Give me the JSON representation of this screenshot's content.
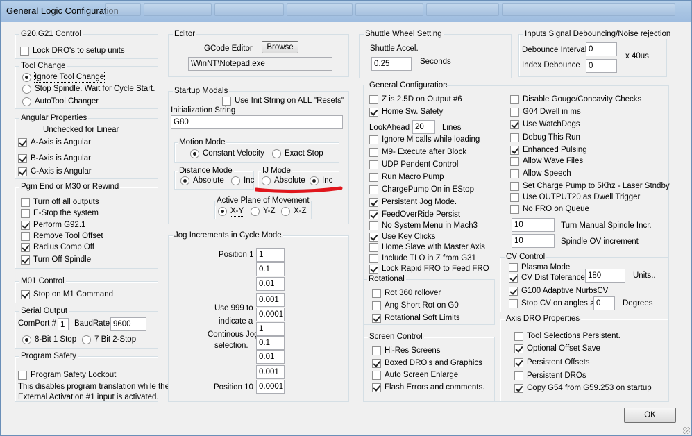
{
  "window": {
    "title": "General Logic Configuration"
  },
  "g2021": {
    "label": "G20,G21 Control",
    "lock_dros": {
      "label": "Lock DRO's to setup units",
      "checked": false
    }
  },
  "tool_change": {
    "label": "Tool Change",
    "options": [
      {
        "label": "Ignore Tool Change",
        "selected": true
      },
      {
        "label": "Stop Spindle. Wait for Cycle Start.",
        "selected": false
      },
      {
        "label": "AutoTool Changer",
        "selected": false
      }
    ]
  },
  "angular": {
    "label": "Angular Properties",
    "note": "Unchecked for Linear",
    "items": [
      {
        "label": "A-Axis is Angular",
        "checked": true
      },
      {
        "label": "B-Axis is Angular",
        "checked": true
      },
      {
        "label": "C-Axis is Angular",
        "checked": true
      }
    ]
  },
  "pgm_end": {
    "label": "Pgm End or M30 or Rewind",
    "items": [
      {
        "label": "Turn off all outputs",
        "checked": false
      },
      {
        "label": "E-Stop the system",
        "checked": false
      },
      {
        "label": "Perform G92.1",
        "checked": true
      },
      {
        "label": "Remove Tool Offset",
        "checked": false
      },
      {
        "label": "Radius Comp Off",
        "checked": true
      },
      {
        "label": "Turn Off Spindle",
        "checked": true
      }
    ]
  },
  "m01": {
    "label": "M01 Control",
    "stop_m1": {
      "label": "Stop on M1 Command",
      "checked": true
    }
  },
  "serial": {
    "label": "Serial Output",
    "comport_label": "ComPort #",
    "comport_value": "1",
    "baud_label": "BaudRate",
    "baud_value": "9600",
    "bit8": {
      "label": "8-Bit 1 Stop",
      "selected": true
    },
    "bit7": {
      "label": "7 Bit 2-Stop",
      "selected": false
    }
  },
  "program_safety": {
    "label": "Program Safety",
    "lockout": {
      "label": "Program Safety Lockout",
      "checked": false
    },
    "desc1": "This disables program translation while the",
    "desc2": "External Activation #1 input is activated."
  },
  "editor": {
    "label": "Editor",
    "gcode_label": "GCode Editor",
    "browse": "Browse",
    "path": "\\WinNT\\Notepad.exe"
  },
  "startup": {
    "label": "Startup Modals",
    "use_init": {
      "label": "Use Init String on ALL  \"Resets\"",
      "checked": false
    },
    "init_label": "Initialization String",
    "init_value": "G80",
    "motion": {
      "label": "Motion Mode",
      "constant": {
        "label": "Constant Velocity",
        "selected": true
      },
      "exact": {
        "label": "Exact Stop",
        "selected": false
      }
    },
    "distance": {
      "label": "Distance Mode",
      "absolute": {
        "label": "Absolute",
        "selected": true
      },
      "inc": {
        "label": "Inc",
        "selected": false
      }
    },
    "ij": {
      "label": "IJ Mode",
      "absolute": {
        "label": "Absolute",
        "selected": false
      },
      "inc": {
        "label": "Inc",
        "selected": true
      }
    },
    "plane": {
      "label": "Active Plane of Movement",
      "xy": {
        "label": "X-Y",
        "selected": true
      },
      "yz": {
        "label": "Y-Z",
        "selected": false
      },
      "xz": {
        "label": "X-Z",
        "selected": false
      }
    }
  },
  "jog": {
    "label": "Jog Increments in Cycle Mode",
    "pos1": "Position 1",
    "pos10": "Position 10",
    "help": [
      "Use 999 to",
      "indicate a",
      "Continous Jog",
      "selection."
    ],
    "values": [
      "1",
      "0.1",
      "0.01",
      "0.001",
      "0.0001",
      "1",
      "0.1",
      "0.01",
      "0.001",
      "0.0001"
    ]
  },
  "shuttle": {
    "label": "Shuttle Wheel Setting",
    "accel_label": "Shuttle Accel.",
    "accel_value": "0.25",
    "seconds": "Seconds"
  },
  "debounce": {
    "label": "Inputs Signal Debouncing/Noise rejection",
    "interval_label": "Debounce Interval",
    "interval_value": "0",
    "units": "x 40us",
    "index_label": "Index Debounce",
    "index_value": "0"
  },
  "general": {
    "label": "General Configuration",
    "z25": {
      "label": "Z is 2.5D on Output #6",
      "checked": false
    },
    "home_safety": {
      "label": "Home Sw. Safety",
      "checked": true
    },
    "lookahead_label": "LookAhead",
    "lookahead_value": "20",
    "lines": "Lines",
    "left": [
      {
        "label": "Ignore M calls while loading",
        "checked": false
      },
      {
        "label": "M9- Execute after Block",
        "checked": false
      },
      {
        "label": "UDP Pendent Control",
        "checked": false
      },
      {
        "label": "Run Macro Pump",
        "checked": false
      },
      {
        "label": "ChargePump On in EStop",
        "checked": false
      },
      {
        "label": "Persistent Jog Mode.",
        "checked": true
      },
      {
        "label": "FeedOverRide Persist",
        "checked": true
      },
      {
        "label": "No System Menu in Mach3",
        "checked": false
      },
      {
        "label": "Use Key Clicks",
        "checked": true
      },
      {
        "label": "Home Slave with Master Axis",
        "checked": false
      },
      {
        "label": "Include TLO in Z from G31",
        "checked": false
      },
      {
        "label": "Lock Rapid FRO to Feed FRO",
        "checked": true
      }
    ],
    "right": [
      {
        "label": "Disable Gouge/Concavity Checks",
        "checked": false
      },
      {
        "label": "G04 Dwell in ms",
        "checked": false
      },
      {
        "label": "Use WatchDogs",
        "checked": true
      },
      {
        "label": "Debug This Run",
        "checked": false
      },
      {
        "label": "Enhanced Pulsing",
        "checked": true
      },
      {
        "label": "Allow Wave Files",
        "checked": false
      },
      {
        "label": "Allow Speech",
        "checked": false
      },
      {
        "label": "Set Charge Pump to 5Khz  - Laser Stndby",
        "checked": false
      },
      {
        "label": "Use OUTPUT20 as Dwell Trigger",
        "checked": false
      },
      {
        "label": "No FRO on Queue",
        "checked": false
      }
    ],
    "turn_manual_value": "10",
    "turn_manual_label": "Turn Manual Spindle Incr.",
    "spindle_ov_value": "10",
    "spindle_ov_label": "Spindle OV increment"
  },
  "rotational": {
    "label": "Rotational",
    "items": [
      {
        "label": "Rot 360 rollover",
        "checked": false
      },
      {
        "label": "Ang Short Rot on G0",
        "checked": false
      },
      {
        "label": "Rotational Soft Limits",
        "checked": true
      }
    ]
  },
  "cv": {
    "label": "CV Control",
    "plasma": {
      "label": "Plasma Mode",
      "checked": false
    },
    "dist": {
      "label": "CV Dist Tolerance",
      "checked": true
    },
    "dist_value": "180",
    "units": "Units..",
    "g100": {
      "label": "G100 Adaptive NurbsCV",
      "checked": true
    },
    "stop_cv": {
      "label": "Stop CV on angles >",
      "checked": false
    },
    "angle_value": "0",
    "degrees": "Degrees"
  },
  "screen": {
    "label": "Screen Control",
    "items": [
      {
        "label": "Hi-Res Screens",
        "checked": false
      },
      {
        "label": "Boxed DRO's and Graphics",
        "checked": true
      },
      {
        "label": "Auto Screen Enlarge",
        "checked": false
      },
      {
        "label": "Flash Errors and comments.",
        "checked": true
      }
    ]
  },
  "axis_dro": {
    "label": "Axis DRO Properties",
    "items": [
      {
        "label": "Tool Selections Persistent.",
        "checked": false
      },
      {
        "label": "Optional Offset Save",
        "checked": true
      },
      {
        "label": "Persistent Offsets",
        "checked": true
      },
      {
        "label": "Persistent DROs",
        "checked": false
      },
      {
        "label": "Copy G54 from G59.253 on startup",
        "checked": true
      }
    ]
  },
  "ok": "OK",
  "colors": {
    "annotation": "#e0161c",
    "titlebar": "#b9d1ea"
  }
}
